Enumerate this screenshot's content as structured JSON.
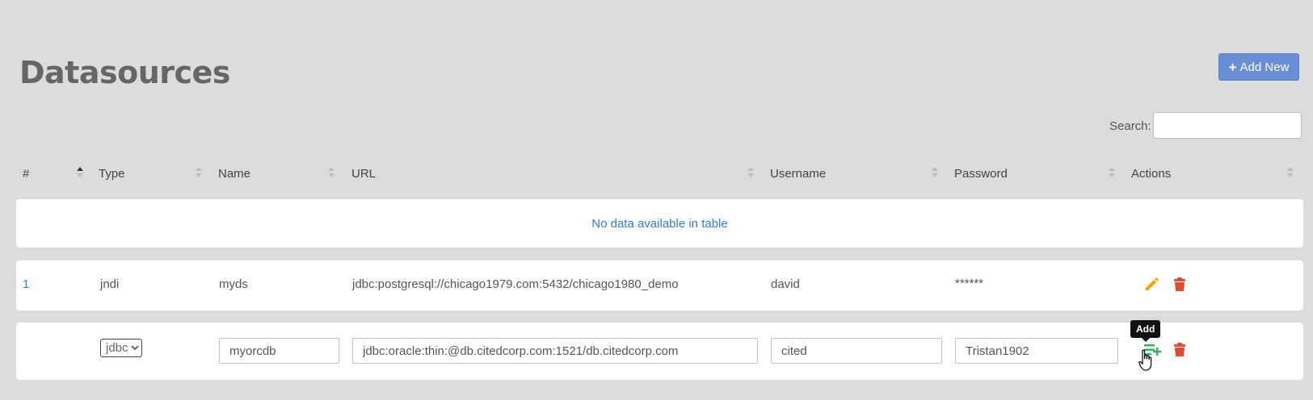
{
  "page": {
    "title": "Datasources"
  },
  "toolbar": {
    "add_new_label": "Add New",
    "add_new_icon": "plus-icon"
  },
  "search": {
    "label": "Search:",
    "value": "",
    "placeholder": ""
  },
  "table": {
    "columns": [
      "#",
      "Type",
      "Name",
      "URL",
      "Username",
      "Password",
      "Actions"
    ],
    "empty_message": "No data available in table",
    "rows": [
      {
        "id": "1",
        "type": "jndi",
        "name": "myds",
        "url": "jdbc:postgresql://chicago1979.com:5432/chicago1980_demo",
        "username": "david",
        "password": "******"
      }
    ],
    "new_row": {
      "type_selected": "jdbc",
      "type_options": [
        "jdbc"
      ],
      "name": "myorcdb",
      "url": "jdbc:oracle:thin:@db.citedcorp.com:1521/db.citedcorp.com",
      "username": "cited",
      "password": "Tristan1902"
    }
  },
  "tooltip": {
    "text": "Add"
  },
  "colors": {
    "background": "#dcdcdc",
    "primary_button": "#6b8fd6",
    "link": "#2f7fd6",
    "edit": "#f0a500",
    "delete": "#e04a2f",
    "add": "#2bb45a"
  }
}
